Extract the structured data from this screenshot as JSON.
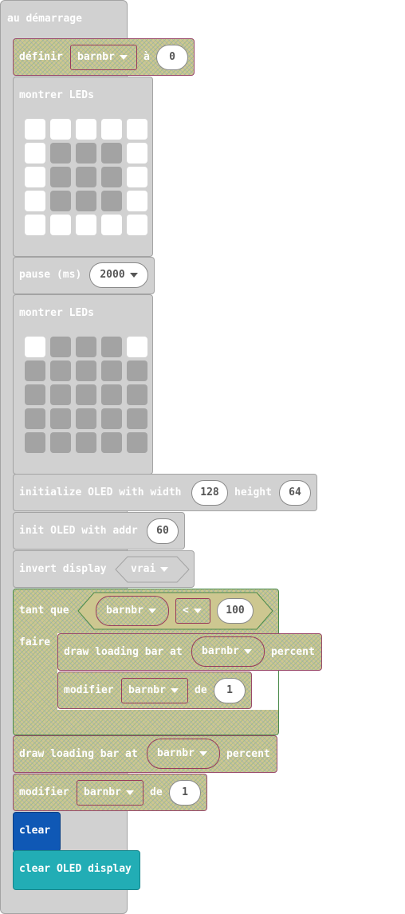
{
  "on_start": {
    "label": "au démarrage"
  },
  "set_var": {
    "label": "définir",
    "var": "barnbr",
    "to": "à",
    "value": "0"
  },
  "show_leds_1": {
    "label": "montrer LEDs",
    "grid": [
      [
        1,
        1,
        1,
        1,
        1
      ],
      [
        1,
        0,
        0,
        0,
        1
      ],
      [
        1,
        0,
        0,
        0,
        1
      ],
      [
        1,
        0,
        0,
        0,
        1
      ],
      [
        1,
        1,
        1,
        1,
        1
      ]
    ]
  },
  "pause": {
    "label": "pause (ms)",
    "value": "2000"
  },
  "show_leds_2": {
    "label": "montrer LEDs",
    "grid": [
      [
        1,
        0,
        0,
        0,
        1
      ],
      [
        0,
        0,
        0,
        0,
        0
      ],
      [
        0,
        0,
        0,
        0,
        0
      ],
      [
        0,
        0,
        0,
        0,
        0
      ],
      [
        0,
        0,
        0,
        0,
        0
      ]
    ]
  },
  "init_oled": {
    "label": "initialize OLED with width",
    "width": "128",
    "height_label": "height",
    "height": "64"
  },
  "init_addr": {
    "label": "init OLED with addr",
    "addr": "60"
  },
  "invert": {
    "label": "invert display",
    "value": "vrai"
  },
  "while": {
    "label": "tant que",
    "var": "barnbr",
    "op": "<",
    "value": "100",
    "do_label": "faire"
  },
  "inner_draw": {
    "label": "draw loading bar at",
    "var": "barnbr",
    "suffix": "percent"
  },
  "inner_change": {
    "label": "modifier",
    "var": "barnbr",
    "by": "de",
    "value": "1"
  },
  "outer_draw": {
    "label": "draw loading bar at",
    "var": "barnbr",
    "suffix": "percent"
  },
  "outer_change": {
    "label": "modifier",
    "var": "barnbr",
    "by": "de",
    "value": "1"
  },
  "clear": {
    "label": "clear"
  },
  "clear_oled": {
    "label": "clear OLED display"
  }
}
